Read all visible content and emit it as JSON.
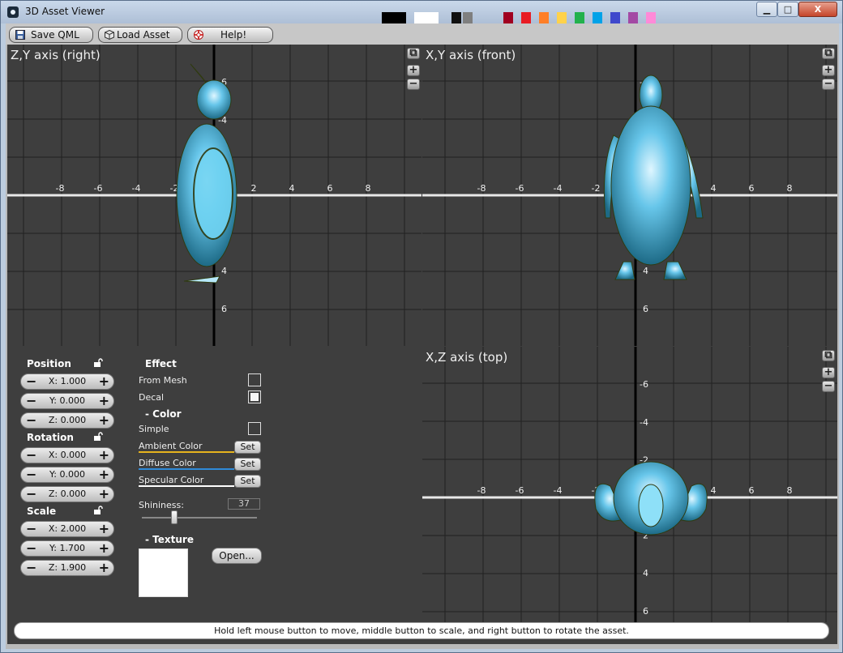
{
  "window": {
    "title": "3D Asset Viewer",
    "swatch_colors": [
      "#000000",
      "#ffffff",
      "#111111",
      "#7f7f7f",
      "#a00020",
      "#e81c24",
      "#ff7f27",
      "#ffd24a",
      "#22b14c",
      "#00a2e8",
      "#3f48cc",
      "#a349a4",
      "#ff8ad8"
    ],
    "controls": {
      "minimize": "▁",
      "maximize": "□",
      "close": "X"
    }
  },
  "toolbar": {
    "save_label": "Save QML",
    "load_label": "Load Asset",
    "help_label": "Help!"
  },
  "views": {
    "right": {
      "title": "Z,Y axis (right)",
      "x_ticks": [
        "-8",
        "-6",
        "-4",
        "-2",
        "2",
        "4",
        "6",
        "8"
      ],
      "y_ticks": [
        "-6",
        "-4",
        "-2",
        "2",
        "4",
        "6"
      ],
      "origin": "0.0"
    },
    "front": {
      "title": "X,Y axis (front)",
      "x_ticks": [
        "-8",
        "-6",
        "-4",
        "-2",
        "2",
        "4",
        "6",
        "8"
      ],
      "y_ticks": [
        "-6",
        "-4",
        "-2",
        "2",
        "4",
        "6"
      ],
      "origin": "0.0"
    },
    "top": {
      "title": "X,Z axis (top)",
      "x_ticks": [
        "-8",
        "-6",
        "-4",
        "-2",
        "2",
        "4",
        "6",
        "8"
      ],
      "y_ticks": [
        "-6",
        "-4",
        "-2",
        "2",
        "4",
        "6"
      ],
      "origin": "0.0"
    },
    "zoom_in": "+",
    "zoom_out": "−"
  },
  "transform": {
    "position": {
      "label": "Position",
      "x": "X: 1.000",
      "y": "Y: 0.000",
      "z": "Z: 0.000"
    },
    "rotation": {
      "label": "Rotation",
      "x": "X: 0.000",
      "y": "Y: 0.000",
      "z": "Z: 0.000"
    },
    "scale": {
      "label": "Scale",
      "x": "X: 2.000",
      "y": "Y: 1.700",
      "z": "Z: 1.900"
    },
    "minus": "−",
    "plus": "+"
  },
  "effect": {
    "title": "Effect",
    "from_mesh": {
      "label": "From Mesh",
      "checked": false
    },
    "decal": {
      "label": "Decal",
      "checked": true
    },
    "color_title": "- Color",
    "simple": {
      "label": "Simple",
      "checked": false
    },
    "ambient": {
      "label": "Ambient Color",
      "color": "#e6b31e"
    },
    "diffuse": {
      "label": "Diffuse Color",
      "color": "#2f8ad8"
    },
    "specular": {
      "label": "Specular Color",
      "color": "#ffffff"
    },
    "set_label": "Set",
    "shininess_label": "Shininess:",
    "shininess_value": "37",
    "texture_title": "- Texture",
    "open_label": "Open..."
  },
  "status": "Hold left mouse button to move, middle button to scale, and right button to rotate the asset."
}
